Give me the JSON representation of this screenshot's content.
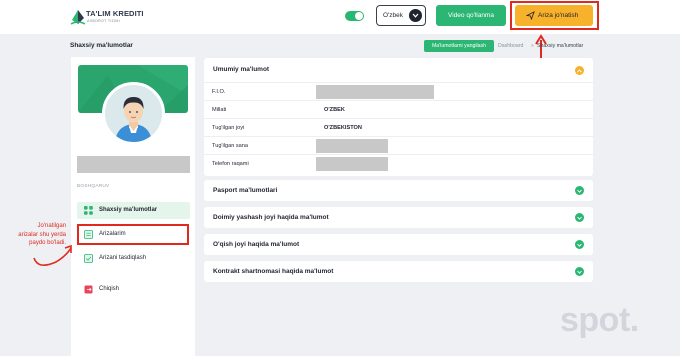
{
  "header": {
    "logo_title": "TA'LIM KREDITI",
    "logo_subtitle": "AXBOROT TIZIMI",
    "theme_toggle": "on",
    "language_label": "O'zbek",
    "video_button": "Video qo'llanma",
    "submit_button": "Ariza jo'natish"
  },
  "subheader": {
    "title": "Shaxsiy ma'lumotlar",
    "update_button": "Ma'lumotlarni yangilash",
    "breadcrumb": [
      "Dashboard",
      "Shaxsiy ma'lumotlar"
    ],
    "breadcrumb_sep": "»"
  },
  "sidebar": {
    "section_label": "BOSHQARUV",
    "items": [
      {
        "label": "Shaxsiy ma'lumotlar",
        "icon": "grid-icon",
        "active": true
      },
      {
        "label": "Arizalarim",
        "icon": "document-icon",
        "active": false
      },
      {
        "label": "Arizani tasdiqlash",
        "icon": "check-document-icon",
        "active": false
      },
      {
        "label": "Chiqish",
        "icon": "logout-icon",
        "active": false
      }
    ]
  },
  "main": {
    "general_title": "Umumiy ma'lumot",
    "general_rows": [
      {
        "label": "F.I.O.",
        "value": ""
      },
      {
        "label": "Millati",
        "value": "O'ZBEK"
      },
      {
        "label": "Tug'ilgan joyi",
        "value": "O'ZBEKISTON"
      },
      {
        "label": "Tug'ilgan sana",
        "value": ""
      },
      {
        "label": "Telefon raqami",
        "value": ""
      }
    ],
    "sections": [
      "Pasport ma'lumotlari",
      "Doimiy yashash joyi haqida ma'lumot",
      "O'qish joyi haqida ma'lumot",
      "Kontrakt shartnomasi haqida ma'lumot"
    ]
  },
  "annotation": {
    "note_lines": [
      "Jo'natilgan",
      "arizalar shu yerda",
      "paydo bo'ladi."
    ]
  },
  "watermark": "spot.",
  "colors": {
    "brand_green": "#2bb673",
    "accent_yellow": "#f7b12a",
    "annotation_red": "#e02a1f"
  }
}
